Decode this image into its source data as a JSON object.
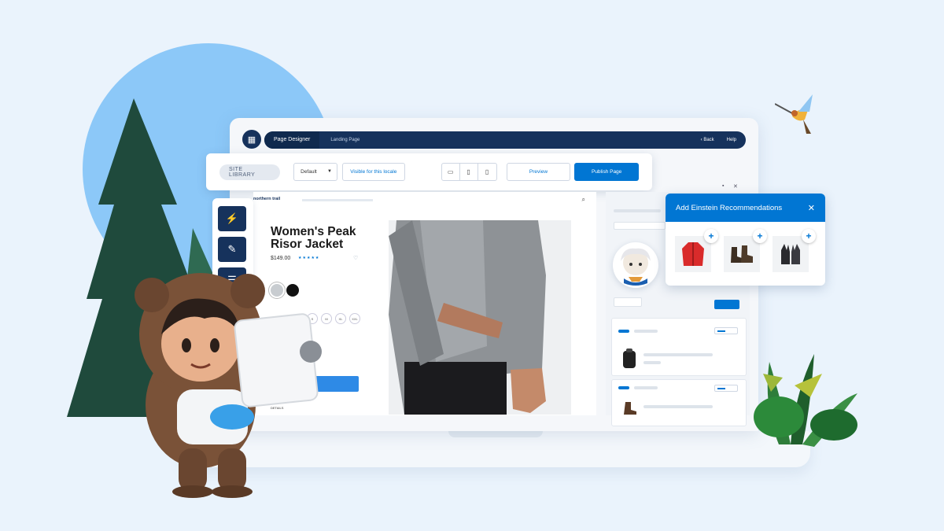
{
  "topbar": {
    "app_title": "Page Designer",
    "tab": "Landing Page",
    "back_label": "Back",
    "help_label": "Help"
  },
  "toolbar": {
    "site_library_label": "SITE LIBRARY",
    "locale_select_value": "Default",
    "visible_label": "Visible for this locale",
    "preview_label": "Preview",
    "publish_label": "Publish Page"
  },
  "side_tools": [
    "lightning-icon",
    "brush-icon",
    "layers-icon"
  ],
  "product": {
    "brand": "northern trail",
    "title": "Women's Peak Risor Jacket",
    "price": "$149.00",
    "stars": "★★★★★",
    "swatch_colors": [
      "#c8ccd0",
      "#111111"
    ],
    "sizes": [
      "S",
      "M",
      "XL",
      "XXL"
    ],
    "details_label": "DETAILS"
  },
  "einstein": {
    "title": "Add Einstein Recommendations",
    "items": [
      "red-jacket-icon",
      "boots-icon",
      "gloves-icon"
    ]
  },
  "colors": {
    "brand_blue": "#0176d3",
    "navy": "#16325c",
    "background": "#eaf3fc"
  }
}
